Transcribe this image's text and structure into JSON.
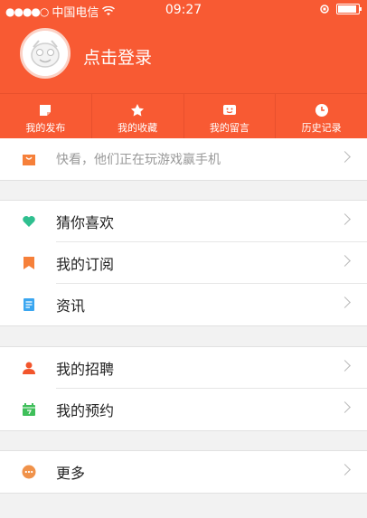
{
  "status_bar": {
    "carrier": "中国电信",
    "time": "09:27"
  },
  "header": {
    "login_label": "点击登录"
  },
  "tabs": [
    {
      "label": "我的发布",
      "icon": "post-icon"
    },
    {
      "label": "我的收藏",
      "icon": "star-icon"
    },
    {
      "label": "我的留言",
      "icon": "message-icon"
    },
    {
      "label": "历史记录",
      "icon": "clock-icon"
    }
  ],
  "promo": {
    "text": "快看，他们正在玩游戏赢手机",
    "icon": "shopping-bag-icon"
  },
  "menu": {
    "guess": {
      "label": "猜你喜欢",
      "icon": "heart-icon"
    },
    "subscribe": {
      "label": "我的订阅",
      "icon": "bookmark-icon"
    },
    "news": {
      "label": "资讯",
      "icon": "document-icon"
    },
    "recruit": {
      "label": "我的招聘",
      "icon": "person-icon"
    },
    "booking": {
      "label": "我的预约",
      "icon": "calendar-icon"
    },
    "more": {
      "label": "更多",
      "icon": "more-dots-icon"
    }
  },
  "colors": {
    "accent": "#f85a33",
    "heart": "#2fbf8f",
    "bookmark": "#f6803a",
    "document": "#3aa6f0",
    "person": "#f2552c",
    "calendar": "#3fbf5a",
    "more": "#f0924a"
  }
}
